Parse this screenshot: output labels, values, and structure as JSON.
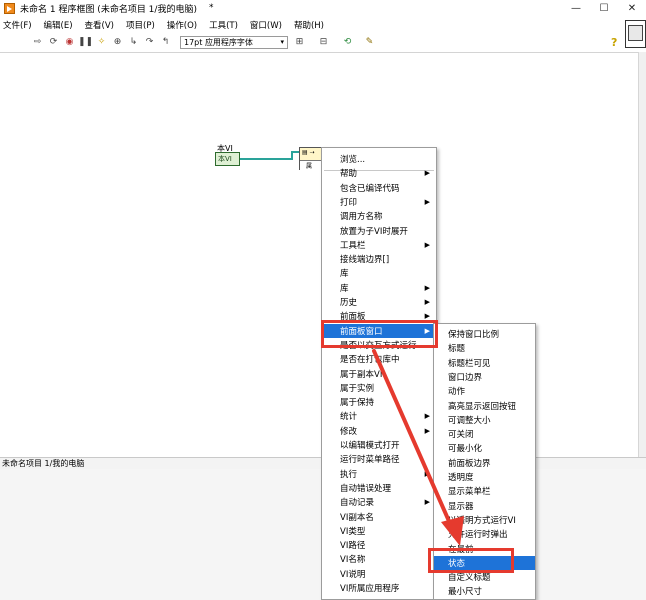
{
  "window": {
    "title": "未命名 1 程序框图 (未命名项目 1/我的电脑)",
    "modified_marker": "*",
    "controls": [
      "—",
      "☐",
      "✕"
    ]
  },
  "menubar": [
    "文件(F)",
    "编辑(E)",
    "查看(V)",
    "项目(P)",
    "操作(O)",
    "工具(T)",
    "窗口(W)",
    "帮助(H)"
  ],
  "toolbar": {
    "font": "17pt 应用程序字体",
    "help_icon": "?"
  },
  "diagram": {
    "this_vi_label": "本VI",
    "this_vi_text": "本VI",
    "prop_node_text": "属"
  },
  "status": {
    "project_path": "未命名项目 1/我的电脑"
  },
  "context_menu": {
    "items": [
      {
        "label": "浏览...",
        "sub": false
      },
      {
        "label": "帮助",
        "sub": true
      },
      {
        "label": "包含已编译代码",
        "sub": false
      },
      {
        "label": "打印",
        "sub": true
      },
      {
        "label": "调用方名称",
        "sub": false
      },
      {
        "label": "放置为子VI时展开",
        "sub": false
      },
      {
        "label": "工具栏",
        "sub": true
      },
      {
        "label": "接线端边界[]",
        "sub": false
      },
      {
        "label": "库",
        "sub": false
      },
      {
        "label": "库",
        "sub": true
      },
      {
        "label": "历史",
        "sub": true
      },
      {
        "label": "前面板",
        "sub": true
      },
      {
        "label": "前面板窗口",
        "sub": true,
        "highlight": true
      },
      {
        "label": "是否以交互方式运行",
        "sub": false
      },
      {
        "label": "是否在打包库中",
        "sub": false
      },
      {
        "label": "属于副本VI",
        "sub": false
      },
      {
        "label": "属于实例",
        "sub": false
      },
      {
        "label": "属于保持",
        "sub": false
      },
      {
        "label": "统计",
        "sub": true
      },
      {
        "label": "修改",
        "sub": true
      },
      {
        "label": "以编辑模式打开",
        "sub": false
      },
      {
        "label": "运行时菜单路径",
        "sub": false
      },
      {
        "label": "执行",
        "sub": true
      },
      {
        "label": "自动错误处理",
        "sub": false
      },
      {
        "label": "自动记录",
        "sub": true
      },
      {
        "label": "VI副本名",
        "sub": false
      },
      {
        "label": "VI类型",
        "sub": false
      },
      {
        "label": "VI路径",
        "sub": false
      },
      {
        "label": "VI名称",
        "sub": false
      },
      {
        "label": "VI说明",
        "sub": false
      },
      {
        "label": "VI所属应用程序",
        "sub": false
      }
    ]
  },
  "submenu": {
    "items": [
      {
        "label": "保持窗口比例"
      },
      {
        "label": "标题"
      },
      {
        "label": "标题栏可见"
      },
      {
        "label": "窗口边界"
      },
      {
        "label": "动作"
      },
      {
        "label": "高亮显示返回按钮"
      },
      {
        "label": "可调整大小"
      },
      {
        "label": "可关闭"
      },
      {
        "label": "可最小化"
      },
      {
        "label": "前面板边界"
      },
      {
        "label": "透明度"
      },
      {
        "label": "显示菜单栏"
      },
      {
        "label": "显示器"
      },
      {
        "label": "以透明方式运行VI"
      },
      {
        "label": "允许运行时弹出"
      },
      {
        "label": "在最前"
      },
      {
        "label": "状态",
        "highlight": true
      },
      {
        "label": "自定义标题"
      },
      {
        "label": "最小尺寸"
      }
    ]
  },
  "colors": {
    "highlight": "#1e73d8",
    "annotation_red": "#e53a2e",
    "wire": "#2aa39a"
  }
}
